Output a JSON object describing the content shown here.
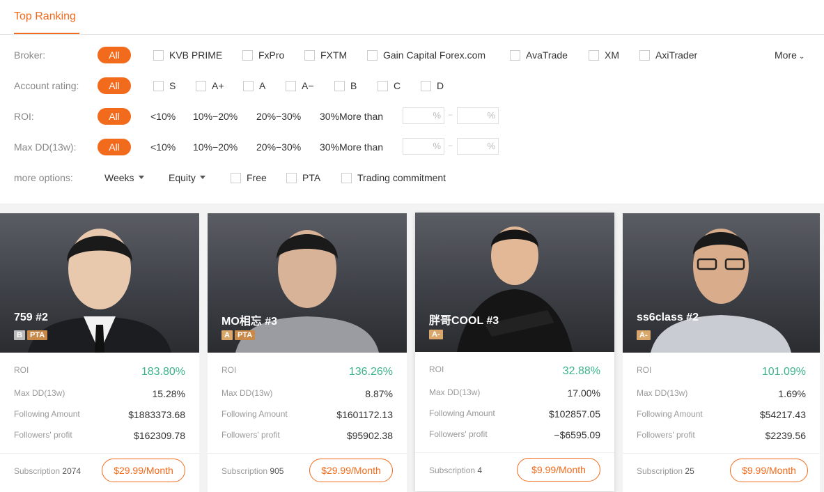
{
  "tab": {
    "label": "Top Ranking"
  },
  "filters": {
    "broker": {
      "label": "Broker:",
      "all": "All",
      "options": [
        "KVB PRIME",
        "FxPro",
        "FXTM",
        "Gain Capital Forex.com",
        "AvaTrade",
        "XM",
        "AxiTrader"
      ],
      "more": "More"
    },
    "rating": {
      "label": "Account rating:",
      "all": "All",
      "options": [
        "S",
        "A+",
        "A",
        "A−",
        "B",
        "C",
        "D"
      ]
    },
    "roi": {
      "label": "ROI:",
      "all": "All",
      "options": [
        "<10%",
        "10%−20%",
        "20%−30%",
        "30%More than"
      ],
      "unit": "%",
      "dash": "−"
    },
    "maxdd": {
      "label": "Max DD(13w):",
      "all": "All",
      "options": [
        "<10%",
        "10%−20%",
        "20%−30%",
        "30%More than"
      ],
      "unit": "%",
      "dash": "−"
    },
    "more_options": {
      "label": "more options:",
      "period": "Weeks",
      "metric": "Equity",
      "checks": [
        "Free",
        "PTA",
        "Trading commitment"
      ]
    }
  },
  "stat_labels": {
    "roi": "ROI",
    "maxdd": "Max DD(13w)",
    "following": "Following Amount",
    "profit": "Followers' profit",
    "subscription": "Subscription"
  },
  "cards": [
    {
      "name": "759 #2",
      "grade": "B",
      "pta": "PTA",
      "roi": "183.80%",
      "maxdd": "15.28%",
      "following": "$1883373.68",
      "profit": "$162309.78",
      "subscribers": "2074",
      "price": "$29.99/Month"
    },
    {
      "name": "MO相忘 #3",
      "grade": "A",
      "pta": "PTA",
      "roi": "136.26%",
      "maxdd": "8.87%",
      "following": "$1601172.13",
      "profit": "$95902.38",
      "subscribers": "905",
      "price": "$29.99/Month"
    },
    {
      "name": "胖哥COOL #3",
      "grade": "A-",
      "pta": "",
      "roi": "32.88%",
      "maxdd": "17.00%",
      "following": "$102857.05",
      "profit": "−$6595.09",
      "subscribers": "4",
      "price": "$9.99/Month"
    },
    {
      "name": "ss6class #2",
      "grade": "A-",
      "pta": "",
      "roi": "101.09%",
      "maxdd": "1.69%",
      "following": "$54217.43",
      "profit": "$2239.56",
      "subscribers": "25",
      "price": "$9.99/Month"
    }
  ],
  "colors": {
    "accent": "#f26a1b",
    "roi_green": "#3db38a"
  }
}
